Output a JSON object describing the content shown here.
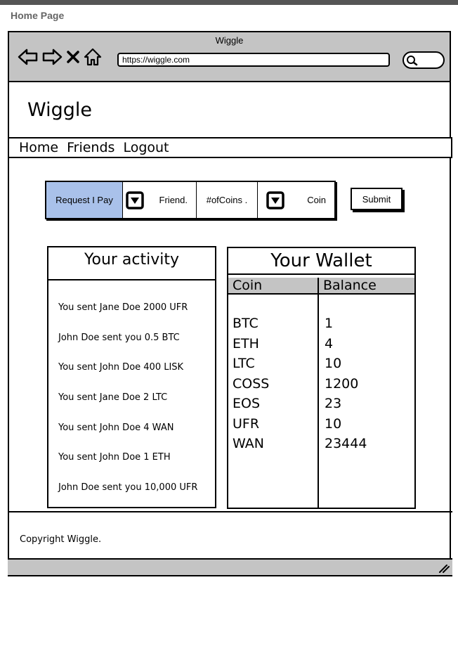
{
  "page_label": "Home Page",
  "window": {
    "title": "Wiggle",
    "url": "https://wiggle.com",
    "nav_icons": [
      "back-arrow-icon",
      "forward-arrow-icon",
      "close-icon",
      "home-icon"
    ]
  },
  "app": {
    "title": "Wiggle"
  },
  "menu": {
    "items": [
      "Home",
      "Friends",
      "Logout"
    ]
  },
  "request_form": {
    "toggle_label": "Request I Pay",
    "friend_label": "Friend.",
    "coins_label": "#ofCoins .",
    "coin_label": "Coin",
    "submit_label": "Submit",
    "accent_color": "#a9c1ea"
  },
  "activity": {
    "title": "Your activity",
    "items": [
      "You sent Jane Doe 2000 UFR",
      "John Doe sent you 0.5 BTC",
      "You sent John Doe 400 LISK",
      "You sent Jane Doe 2 LTC",
      "You sent John Doe 4 WAN",
      "You sent John Doe 1 ETH",
      "John Doe sent you 10,000 UFR"
    ]
  },
  "wallet": {
    "title": "Your Wallet",
    "columns": [
      "Coin",
      "Balance"
    ],
    "rows": [
      {
        "coin": "BTC",
        "balance": "1"
      },
      {
        "coin": "ETH",
        "balance": "4"
      },
      {
        "coin": "LTC",
        "balance": "10"
      },
      {
        "coin": "COSS",
        "balance": "1200"
      },
      {
        "coin": "EOS",
        "balance": "23"
      },
      {
        "coin": "UFR",
        "balance": "10"
      },
      {
        "coin": "WAN",
        "balance": "23444"
      }
    ]
  },
  "footer": {
    "copyright": "Copyright Wiggle."
  }
}
